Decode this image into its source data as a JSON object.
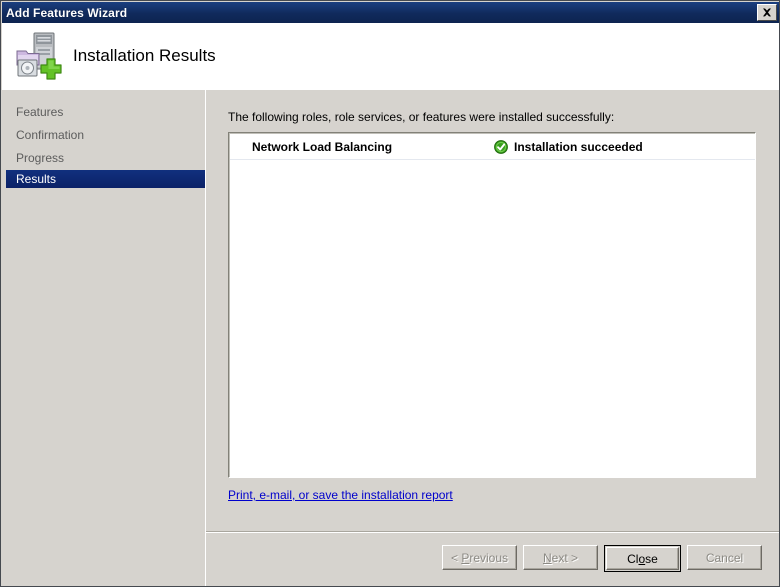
{
  "window": {
    "title": "Add Features Wizard",
    "close_icon": "close-icon"
  },
  "header": {
    "title": "Installation Results",
    "icon": "add-features-server-icon"
  },
  "sidebar": {
    "items": [
      {
        "label": "Features",
        "selected": false
      },
      {
        "label": "Confirmation",
        "selected": false
      },
      {
        "label": "Progress",
        "selected": false
      },
      {
        "label": "Results",
        "selected": true
      }
    ]
  },
  "main": {
    "intro_text": "The following roles, role services, or features were installed successfully:",
    "results": [
      {
        "name": "Network Load Balancing",
        "status": "Installation succeeded",
        "status_icon": "success-check-icon"
      }
    ],
    "report_link": "Print, e-mail, or save the installation report"
  },
  "footer": {
    "buttons": [
      {
        "label": "< Previous",
        "accel_before": "< ",
        "accel": "P",
        "accel_after": "revious",
        "enabled": false,
        "default": false
      },
      {
        "label": "Next >",
        "accel_before": "",
        "accel": "N",
        "accel_after": "ext >",
        "enabled": false,
        "default": false
      },
      {
        "label": "Close",
        "accel_before": "Cl",
        "accel": "o",
        "accel_after": "se",
        "enabled": true,
        "default": true
      },
      {
        "label": "Cancel",
        "accel_before": "Cancel",
        "accel": "",
        "accel_after": "",
        "enabled": false,
        "default": false
      }
    ]
  },
  "colors": {
    "titlebar": "#123168",
    "window_face": "#d6d3ce",
    "selection": "#0a2472",
    "link": "#0000cc",
    "success_green": "#3a9e20"
  }
}
